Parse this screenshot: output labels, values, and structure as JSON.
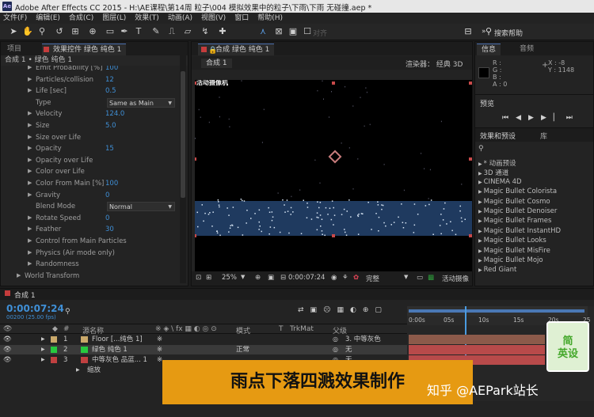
{
  "titlebar": {
    "app_badge": "Ae",
    "title": "Adobe After Effects CC 2015 - H:\\AE课程\\第14周 粒子\\004 模拟效果中的粒子\\下雨\\下雨 无碰撞.aep *"
  },
  "menu": [
    "文件(F)",
    "编辑(E)",
    "合成(C)",
    "图层(L)",
    "效果(T)",
    "动画(A)",
    "视图(V)",
    "窗口",
    "帮助(H)"
  ],
  "toolbar": {
    "snap_label": "对齐",
    "search_label": "搜索帮助"
  },
  "left_panel": {
    "tab_project": "项目",
    "tab_effects": "效果控件 绿色 纯色 1",
    "subheader": "合成 1 • 绿色 纯色 1",
    "rows": [
      {
        "indent": 1,
        "label": "Emit Probability [%]",
        "value": "100"
      },
      {
        "indent": 1,
        "label": "Particles/collision",
        "value": "12"
      },
      {
        "indent": 1,
        "label": "Life [sec]",
        "value": "0.5"
      },
      {
        "indent": 1,
        "label": "Type",
        "dropdown": "Same as Main"
      },
      {
        "indent": 1,
        "label": "Velocity",
        "value": "124.0"
      },
      {
        "indent": 1,
        "label": "Size",
        "value": "5.0"
      },
      {
        "indent": 1,
        "label": "Size over Life",
        "value": ""
      },
      {
        "indent": 1,
        "label": "Opacity",
        "value": "15"
      },
      {
        "indent": 1,
        "label": "Opacity over Life",
        "value": ""
      },
      {
        "indent": 1,
        "label": "Color over Life",
        "value": ""
      },
      {
        "indent": 1,
        "label": "Color From Main [%]",
        "value": "100"
      },
      {
        "indent": 1,
        "label": "Gravity",
        "value": "0"
      },
      {
        "indent": 1,
        "label": "Blend Mode",
        "dropdown": "Normal"
      },
      {
        "indent": 1,
        "label": "Rotate Speed",
        "value": "0"
      },
      {
        "indent": 1,
        "label": "Feather",
        "value": "30"
      },
      {
        "indent": 1,
        "label": "Control from Main Particles",
        "value": ""
      },
      {
        "indent": 1,
        "label": "Physics (Air mode only)",
        "value": ""
      },
      {
        "indent": 1,
        "label": "Randomness",
        "value": ""
      },
      {
        "indent": 0,
        "label": "World Transform",
        "value": ""
      }
    ]
  },
  "comp_panel": {
    "tab": "合成 绿色 纯色 1",
    "subtab": "合成 1",
    "renderer": "渲染器：  经典 3D",
    "camera_label": "活动摄像机",
    "zoom": "25%",
    "timecode": "0:00:07:24",
    "resolution": "完整",
    "view": "活动摄像"
  },
  "right_panel": {
    "tab_info": "信息",
    "tab_audio": "音频",
    "info": {
      "r": "R :",
      "g": "G :",
      "b": "B :",
      "a": "A : 0",
      "x": "X : -8",
      "y": "Y : 1148"
    },
    "preview_label": "预览",
    "effects_tab": "效果和预设",
    "library_tab": "库",
    "items": [
      "* 动画预设",
      "3D 通道",
      "CINEMA 4D",
      "Magic Bullet Colorista",
      "Magic Bullet Cosmo",
      "Magic Bullet Denoiser",
      "Magic Bullet Frames",
      "Magic Bullet InstantHD",
      "Magic Bullet Looks",
      "Magic Bullet MisFire",
      "Magic Bullet Mojo",
      "Red Giant"
    ]
  },
  "timeline": {
    "tab": "合成 1",
    "timecode": "0:00:07:24",
    "frame_info": "00200 (25.00 fps)",
    "col_name": "源名称",
    "col_mode": "模式",
    "col_t": "T",
    "col_trkmat": "TrkMat",
    "col_parent": "父级",
    "ruler": [
      "0:00s",
      "05s",
      "10s",
      "15s",
      "20s",
      "25"
    ],
    "playhead_fraction": 0.32,
    "layers": [
      {
        "num": "1",
        "color": "#c9a86a",
        "name": "Floor [...纯色 1]",
        "mode": "",
        "parent": "3. 中等灰色"
      },
      {
        "num": "2",
        "color": "#27c93f",
        "name": "绿色 纯色 1",
        "mode": "正常",
        "parent": "无"
      },
      {
        "num": "3",
        "color": "#c04040",
        "name": "中等灰色 品蓝... 1",
        "mode": "",
        "parent": "无"
      }
    ],
    "sub_prop": "缩放"
  },
  "overlay": {
    "caption": "雨点下落四溅效果制作",
    "watermark": "知乎 @AEPark站长",
    "logo_line1": "简",
    "logo_line2": "英设"
  }
}
